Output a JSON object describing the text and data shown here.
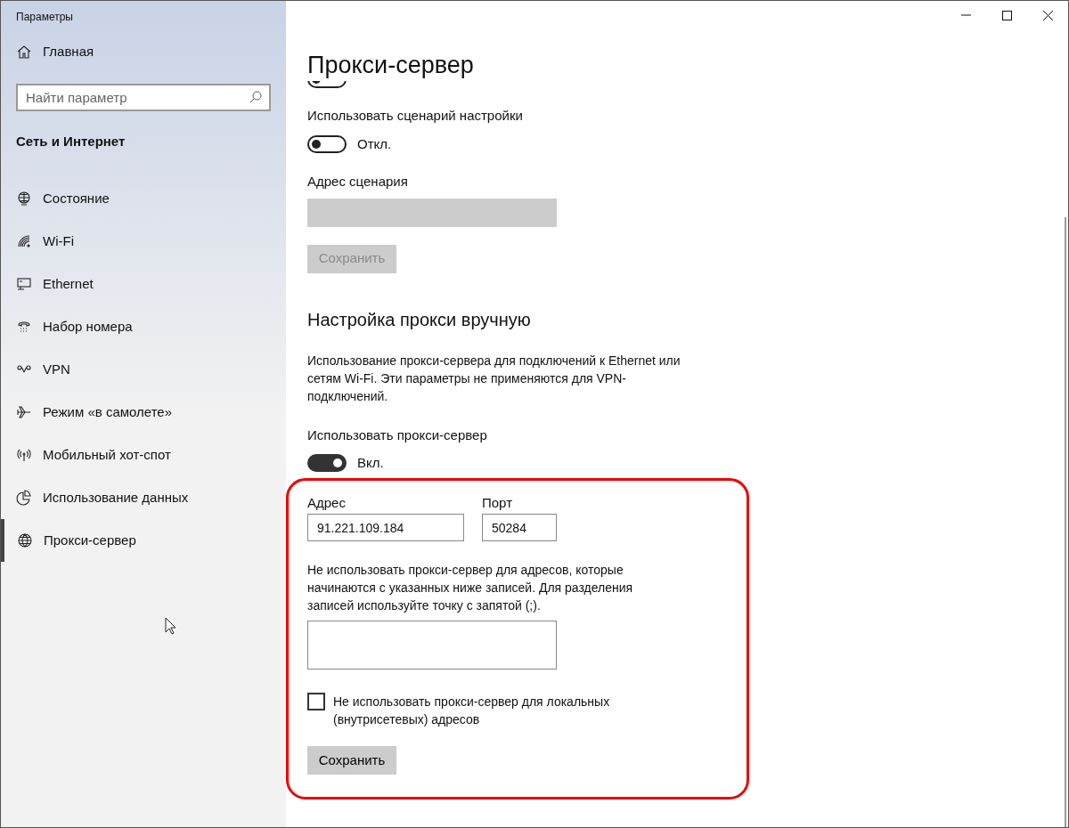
{
  "window": {
    "title": "Параметры"
  },
  "sidebar": {
    "home": "Главная",
    "search": {
      "placeholder": "Найти параметр"
    },
    "section": "Сеть и Интернет",
    "items": [
      {
        "label": "Состояние",
        "selected": false
      },
      {
        "label": "Wi-Fi",
        "selected": false
      },
      {
        "label": "Ethernet",
        "selected": false
      },
      {
        "label": "Набор номера",
        "selected": false
      },
      {
        "label": "VPN",
        "selected": false
      },
      {
        "label": "Режим «в самолете»",
        "selected": false
      },
      {
        "label": "Мобильный хот-спот",
        "selected": false
      },
      {
        "label": "Использование данных",
        "selected": false
      },
      {
        "label": "Прокси-сервер",
        "selected": true
      }
    ]
  },
  "page": {
    "title": "Прокси-сервер",
    "scrolled_toggle": {
      "on": false
    },
    "script": {
      "label": "Использовать сценарий настройки",
      "on": false,
      "state_text": "Откл."
    },
    "script_address": {
      "label": "Адрес сценария",
      "disabled": true
    },
    "script_save": {
      "label": "Сохранить",
      "disabled": true
    },
    "manual": {
      "heading": "Настройка прокси вручную",
      "description": "Использование прокси-сервера для подключений к Ethernet или сетям Wi-Fi. Эти параметры не применяются для VPN-подключений.",
      "use_proxy": {
        "label": "Использовать прокси-сервер",
        "on": true,
        "state_text": "Вкл."
      },
      "address": {
        "label": "Адрес",
        "value": "91.221.109.184"
      },
      "port": {
        "label": "Порт",
        "value": "50284"
      },
      "exceptions": {
        "label": "Не использовать прокси-сервер для адресов, которые начинаются с указанных ниже записей. Для разделения записей используйте точку с запятой (;)."
      },
      "local": {
        "label": "Не использовать прокси-сервер для локальных (внутрисетевых) адресов",
        "checked": false
      },
      "save": {
        "label": "Сохранить",
        "disabled": false
      }
    }
  }
}
